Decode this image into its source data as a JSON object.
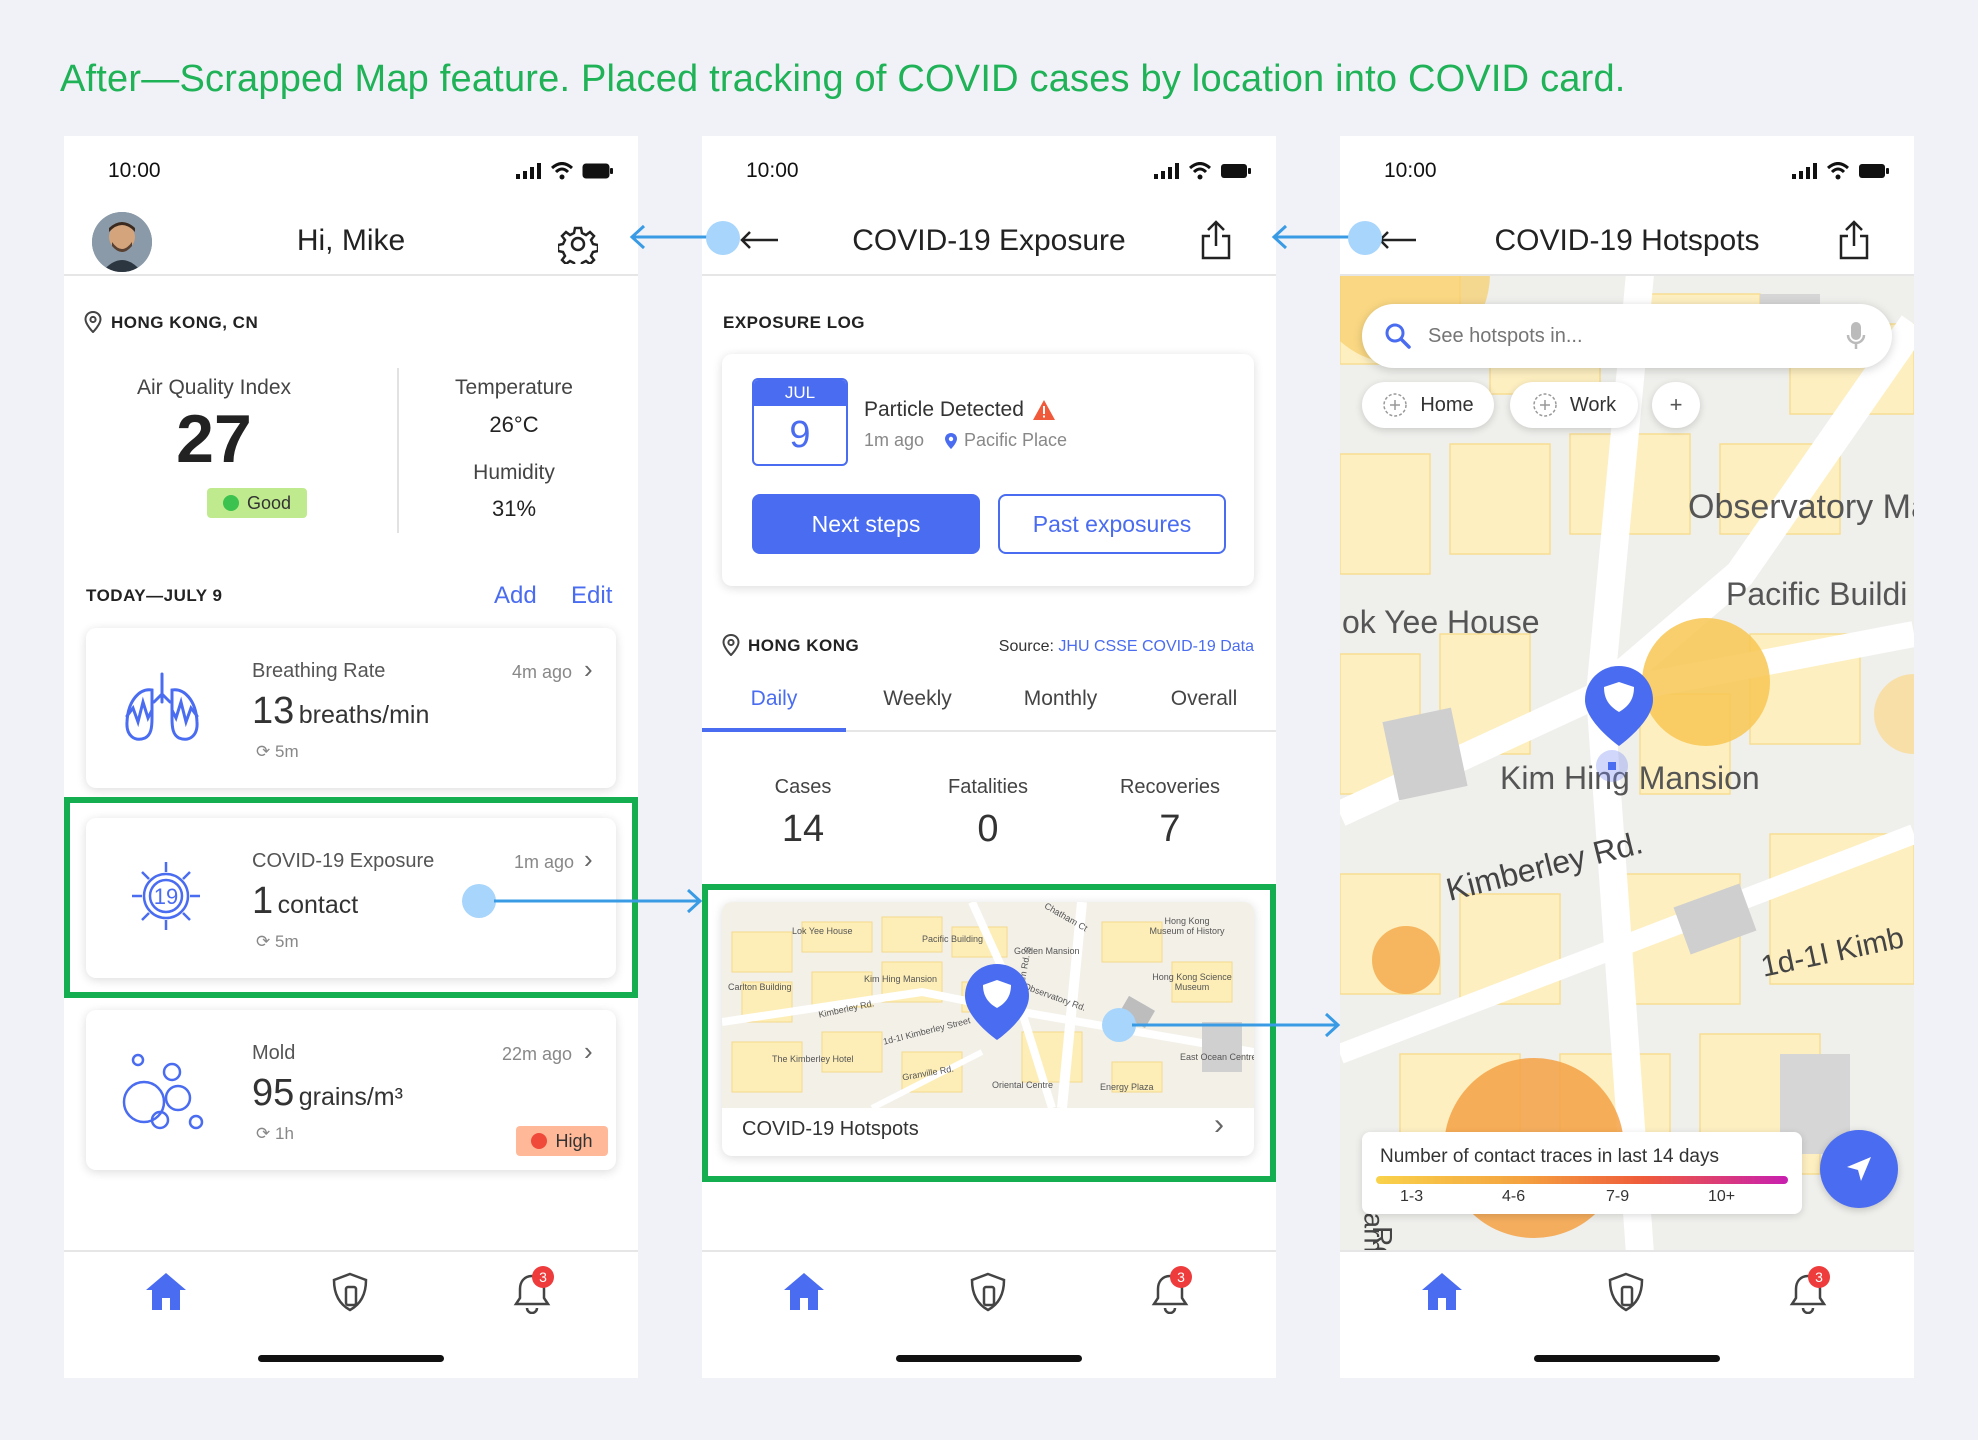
{
  "caption": "After—Scrapped Map feature. Placed tracking of COVID cases by location into COVID card.",
  "status_time": "10:00",
  "colors": {
    "caption": "#1fb256",
    "frame": "#14ad50",
    "accent": "#4a6cf0",
    "link": "#3a9be5"
  },
  "screen1": {
    "greeting": "Hi, Mike",
    "location": "HONG KONG, CN",
    "aqi_label": "Air Quality Index",
    "aqi_value": "27",
    "aqi_status": "Good",
    "temp_label": "Temperature",
    "temp_value": "26°C",
    "humidity_label": "Humidity",
    "humidity_value": "31%",
    "section_label": "TODAY—JULY 9",
    "add_label": "Add",
    "edit_label": "Edit",
    "cards": [
      {
        "title": "Breathing Rate",
        "value": "13",
        "unit": "breaths/min",
        "ago": "4m ago",
        "refresh": "5m"
      },
      {
        "title": "COVID-19 Exposure",
        "value": "1",
        "unit": "contact",
        "ago": "1m ago",
        "refresh": "5m"
      },
      {
        "title": "Mold",
        "value": "95",
        "unit": "grains/m³",
        "ago": "22m ago",
        "refresh": "1h",
        "badge": "High"
      }
    ],
    "notif_count": "3"
  },
  "screen2": {
    "title": "COVID-19 Exposure",
    "log_label": "EXPOSURE LOG",
    "cal_month": "JUL",
    "cal_day": "9",
    "event_title": "Particle Detected",
    "event_ago": "1m ago",
    "event_place": "Pacific Place",
    "next_steps": "Next steps",
    "past_exposures": "Past exposures",
    "region": "HONG KONG",
    "source_label": "Source:",
    "source_link": "JHU CSSE COVID-19 Data",
    "tabs": [
      "Daily",
      "Weekly",
      "Monthly",
      "Overall"
    ],
    "active_tab": "Daily",
    "stats": [
      {
        "label": "Cases",
        "value": "14"
      },
      {
        "label": "Fatalities",
        "value": "0"
      },
      {
        "label": "Recoveries",
        "value": "7"
      }
    ],
    "map_labels": [
      "Lok Yee House",
      "Pacific Building",
      "Chatham Ct",
      "Hong Kong Museum of History",
      "Golden Mansion",
      "Carlton Building",
      "Kim Hing Mansion",
      "Kimberley Rd.",
      "Observatory Rd.",
      "Chatham Rd. S",
      "Hong Kong Science Museum",
      "1d-1I Kimberley Street",
      "The Kimberley Hotel",
      "Granville Rd.",
      "Oriental Centre",
      "Energy Plaza",
      "East Ocean Centre"
    ],
    "hotspots_label": "COVID-19 Hotspots",
    "notif_count": "3"
  },
  "screen3": {
    "title": "COVID-19 Hotspots",
    "search_placeholder": "See hotspots in...",
    "chips": [
      "Home",
      "Work"
    ],
    "add_chip": "+",
    "map_labels": [
      "Observatory Ma",
      "Pacific Buildi",
      "ok Yee House",
      "Kim Hing Mansion",
      "Kimberley Rd.",
      "1d-1I Kimb",
      "arnarvo",
      "Ro"
    ],
    "legend_title": "Number of contact traces in last 14 days",
    "legend_ticks": [
      "1-3",
      "4-6",
      "7-9",
      "10+"
    ],
    "notif_count": "3"
  }
}
